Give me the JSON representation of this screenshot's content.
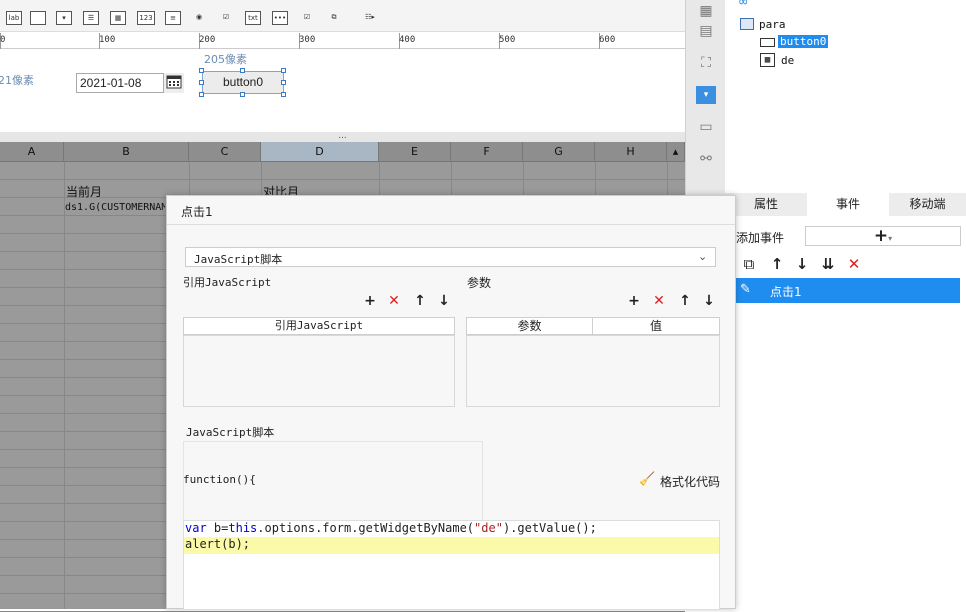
{
  "toolbar": {
    "icons": [
      "label-icon",
      "textbox-icon",
      "combobox-icon",
      "list-icon",
      "date-icon",
      "number-icon",
      "textarea-icon",
      "radio-group-icon",
      "checkbox-group-icon",
      "text-icon",
      "password-icon",
      "checkbox-icon",
      "tree-icon",
      "more-icon"
    ],
    "label_text": "lab",
    "number_text": "123",
    "text_text": "txt"
  },
  "ruler": {
    "labels": [
      "0",
      "100",
      "200",
      "300",
      "400",
      "500",
      "600"
    ]
  },
  "canvas": {
    "left_px_label": "21像素",
    "top_px_label": "205像素",
    "date_value": "2021-01-08",
    "button_label": "button0"
  },
  "splitter": {
    "dots": "..."
  },
  "grid": {
    "columns": [
      "A",
      "B",
      "C",
      "D",
      "E",
      "F",
      "G",
      "H"
    ],
    "cells": {
      "b2": "当前月",
      "d2": "对比月",
      "b3": "ds1.G(CUSTOMERNAM"
    }
  },
  "tree": {
    "root": "para",
    "items": [
      "button0",
      "de"
    ]
  },
  "right_tabs": [
    "属性",
    "事件",
    "移动端"
  ],
  "events": {
    "add_label": "添加事件",
    "add_symbol": "+",
    "items": [
      "点击1"
    ]
  },
  "dialog": {
    "title": "点击1",
    "type_select": "JavaScript脚本",
    "ref_section": "引用JavaScript",
    "param_section": "参数",
    "ref_col": "引用JavaScript",
    "param_col": "参数",
    "value_col": "值",
    "script_section": "JavaScript脚本",
    "func_sig": "function(){",
    "format_label": "格式化代码",
    "code_line1_kw": "var",
    "code_line1_a": " b=",
    "code_line1_this": "this",
    "code_line1_b": ".options.form.getWidgetByName(",
    "code_line1_str": "\"de\"",
    "code_line1_c": ").getValue();",
    "code_line2": "alert(b);"
  },
  "colors": {
    "accent": "#3a8fe0",
    "selected": "#1f8df0",
    "code_keyword": "#0000cc",
    "code_string": "#aa2222",
    "code_highlight": "#fafaa8"
  }
}
